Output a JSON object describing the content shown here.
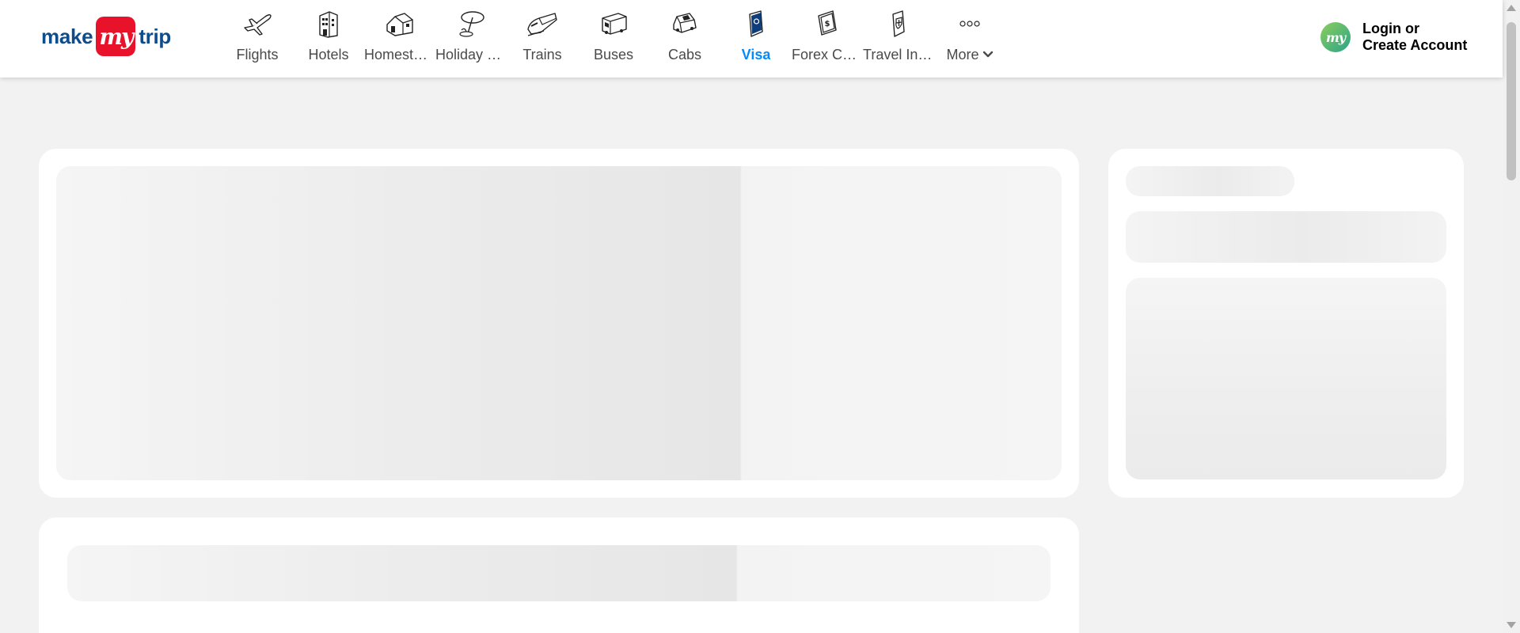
{
  "header": {
    "logo": {
      "left": "make",
      "badge": "my",
      "right": "trip"
    },
    "nav": [
      {
        "label": "Flights",
        "icon": "plane-icon",
        "active": false
      },
      {
        "label": "Hotels",
        "icon": "building-icon",
        "active": false
      },
      {
        "label": "Homestays & Villas",
        "icon": "house-icon",
        "active": false
      },
      {
        "label": "Holiday Packages",
        "icon": "umbrella-icon",
        "active": false
      },
      {
        "label": "Trains",
        "icon": "train-icon",
        "active": false
      },
      {
        "label": "Buses",
        "icon": "bus-icon",
        "active": false
      },
      {
        "label": "Cabs",
        "icon": "car-icon",
        "active": false
      },
      {
        "label": "Visa",
        "icon": "passport-icon",
        "active": true
      },
      {
        "label": "Forex Card & Currency",
        "icon": "forex-card-icon",
        "active": false
      },
      {
        "label": "Travel Insurance",
        "icon": "shield-card-icon",
        "active": false
      },
      {
        "label": "More",
        "icon": "more-dots-icon",
        "active": false
      }
    ],
    "login": {
      "avatar": "my",
      "line1": "Login or",
      "line2": "Create Account"
    }
  },
  "colors": {
    "brand_blue": "#0f4c8c",
    "brand_red": "#e8132b",
    "active_blue": "#008cff",
    "page_bg": "#f2f2f2"
  }
}
